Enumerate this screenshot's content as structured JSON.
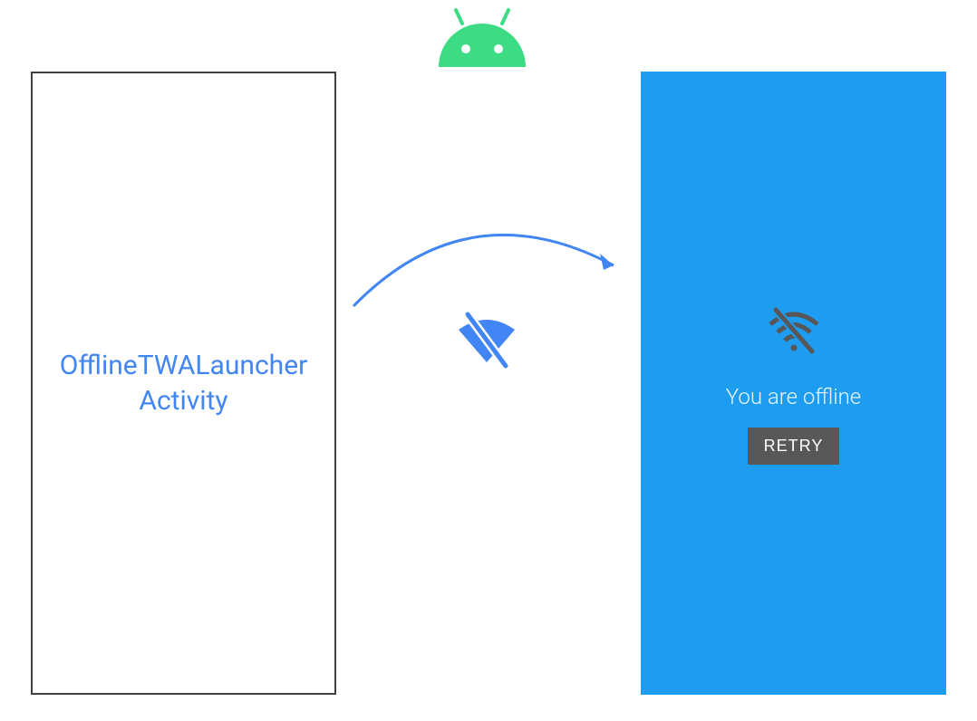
{
  "android_logo": {
    "color": "#3ddc84"
  },
  "left_panel": {
    "line1": "OfflineTWALauncher",
    "line2": "Activity",
    "text_color": "#4285f4",
    "border_color": "#404040"
  },
  "right_panel": {
    "background": "#1e9df0",
    "message": "You are offline",
    "button_label": "RETRY",
    "button_bg": "#585858",
    "icon_color": "#585858"
  },
  "arrow": {
    "color": "#4285f4"
  },
  "center_wifi_icon": {
    "color": "#4285f4"
  }
}
